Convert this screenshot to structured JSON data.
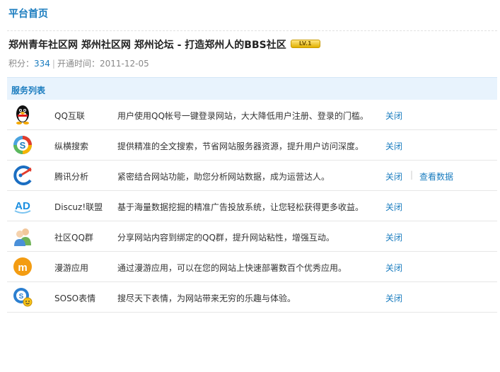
{
  "header": {
    "title": "平台首页"
  },
  "site": {
    "name": "郑州青年社区网 郑州社区网 郑州论坛 - 打造郑州人的BBS社区",
    "level_badge": "LV.1",
    "score_label": "积分：",
    "score": "334",
    "open_label": "开通时间：",
    "open_date": "2011-12-05"
  },
  "services": {
    "heading": "服务列表",
    "items": [
      {
        "icon": "qq-penguin-icon",
        "name": "QQ互联",
        "desc": "用户使用QQ帐号一键登录网站，大大降低用户注册、登录的门槛。",
        "action": "关闭"
      },
      {
        "icon": "soso-search-icon",
        "name": "纵横搜索",
        "desc": "提供精准的全文搜索，节省网站服务器资源，提升用户访问深度。",
        "action": "关闭"
      },
      {
        "icon": "analytics-icon",
        "name": "腾讯分析",
        "desc": "紧密结合网站功能，助您分析网站数据，成为运营达人。",
        "action": "关闭",
        "action2": "查看数据"
      },
      {
        "icon": "ad-union-icon",
        "name": "Discuz!联盟",
        "desc": "基于海量数据挖掘的精准广告投放系统，让您轻松获得更多收益。",
        "action": "关闭"
      },
      {
        "icon": "qq-group-icon",
        "name": "社区QQ群",
        "desc": "分享网站内容到绑定的QQ群，提升网站粘性，增强互动。",
        "action": "关闭"
      },
      {
        "icon": "manyou-icon",
        "name": "漫游应用",
        "desc": "通过漫游应用，可以在您的网站上快速部署数百个优秀应用。",
        "action": "关闭"
      },
      {
        "icon": "soso-emoticon-icon",
        "name": "SOSO表情",
        "desc": "搜尽天下表情，为网站带来无穷的乐趣与体验。",
        "action": "关闭"
      }
    ]
  }
}
